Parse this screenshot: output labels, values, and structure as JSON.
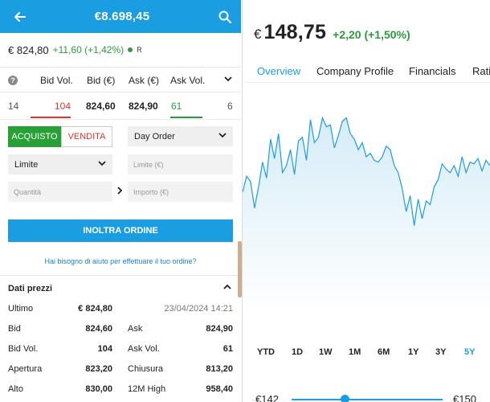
{
  "left": {
    "topbar": {
      "title": "€8.698,45"
    },
    "quote": {
      "last": "€ 824,80",
      "change": "+11,60 (+1,42%)",
      "market": "R"
    },
    "book": {
      "headers": {
        "bid_vol": "Bid Vol.",
        "bid": "Bid (€)",
        "ask": "Ask (€)",
        "ask_vol": "Ask Vol."
      },
      "row": {
        "left_count": "14",
        "bid_vol": "104",
        "bid": "824,60",
        "ask": "824,90",
        "ask_vol": "61",
        "right_count": "6"
      }
    },
    "order": {
      "buy_label": "ACQUISTO",
      "sell_label": "VENDITA",
      "validity": "Day Order",
      "type": "Limite",
      "limit_placeholder": "Limite (€)",
      "qty_placeholder": "Quantità",
      "amount_placeholder": "Importo (€)",
      "send_label": "INOLTRA ORDINE",
      "help_link": "Hai bisogno di aiuto per effettuare il tuo ordine?"
    },
    "prices": {
      "title": "Dati prezzi",
      "rows": [
        {
          "k1": "Ultimo",
          "v1": "€ 824,80",
          "k2": "",
          "v2": "23/04/2024 14:21"
        },
        {
          "k1": "Bid",
          "v1": "824,60",
          "k2": "Ask",
          "v2": "824,90"
        },
        {
          "k1": "Bid Vol.",
          "v1": "104",
          "k2": "Ask Vol.",
          "v2": "61"
        },
        {
          "k1": "Apertura",
          "v1": "823,20",
          "k2": "Chiusura",
          "v2": "813,20"
        },
        {
          "k1": "Alto",
          "v1": "830,00",
          "k2": "12M High",
          "v2": "958,40"
        }
      ]
    }
  },
  "right": {
    "currency": "€",
    "price": "148,75",
    "change": "+2,20 (+1,50%)",
    "tabs": [
      "Overview",
      "Company Profile",
      "Financials",
      "Ratio"
    ],
    "active_tab": "Overview",
    "ranges": [
      "YTD",
      "1D",
      "1W",
      "1M",
      "6M",
      "1Y",
      "3Y",
      "5Y"
    ],
    "active_range": "5Y",
    "slider_min": "€142",
    "slider_max": "€150"
  },
  "colors": {
    "accent": "#1b9de2",
    "positive": "#2e9a3c",
    "negative": "#e0352e"
  },
  "chart_data": {
    "type": "area",
    "title": "",
    "xlabel": "",
    "ylabel": "",
    "range": "5Y",
    "series": [
      {
        "values": [
          0.55,
          0.64,
          0.61,
          0.46,
          0.58,
          0.72,
          0.63,
          0.85,
          0.74,
          0.88,
          0.66,
          0.7,
          0.79,
          0.65,
          0.84,
          0.86,
          0.73,
          0.96,
          0.83,
          0.86,
          0.97,
          0.92,
          0.93,
          0.8,
          0.87,
          0.95,
          0.97,
          0.88,
          0.85,
          0.79,
          0.83,
          0.75,
          0.77,
          0.73,
          0.72,
          0.75,
          0.81,
          0.79,
          0.7,
          0.66,
          0.57,
          0.44,
          0.53,
          0.36,
          0.51,
          0.4,
          0.5,
          0.48,
          0.58,
          0.62,
          0.71,
          0.68,
          0.66,
          0.7,
          0.64,
          0.75,
          0.66,
          0.72,
          0.71,
          0.74,
          0.67,
          0.73,
          0.7
        ]
      }
    ]
  }
}
